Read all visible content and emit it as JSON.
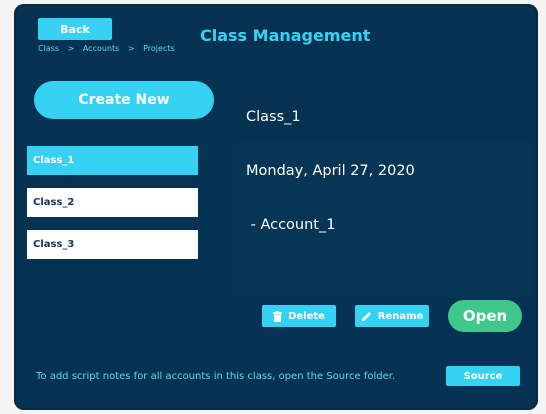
{
  "header": {
    "back_label": "Back",
    "breadcrumb": [
      "Class",
      ">",
      "Accounts",
      ">",
      "Projects"
    ],
    "title": "Class Management"
  },
  "sidebar": {
    "create_label": "Create New",
    "items": [
      {
        "label": "Class_1",
        "selected": true
      },
      {
        "label": "Class_2",
        "selected": false
      },
      {
        "label": "Class_3",
        "selected": false
      }
    ]
  },
  "details": {
    "line1": "Class_1",
    "line2": "Monday, April 27, 2020",
    "line3": " - Account_1"
  },
  "actions": {
    "delete_label": "Delete",
    "rename_label": "Rename",
    "open_label": "Open"
  },
  "footer": {
    "note": "To add script notes for all accounts in this class, open the Source folder.",
    "source_label": "Source"
  },
  "colors": {
    "panel_bg": "#063353",
    "accent": "#35d2f4",
    "open_green": "#3ec88a"
  },
  "icons": {
    "delete": "trash-icon",
    "rename": "pencil-icon"
  }
}
